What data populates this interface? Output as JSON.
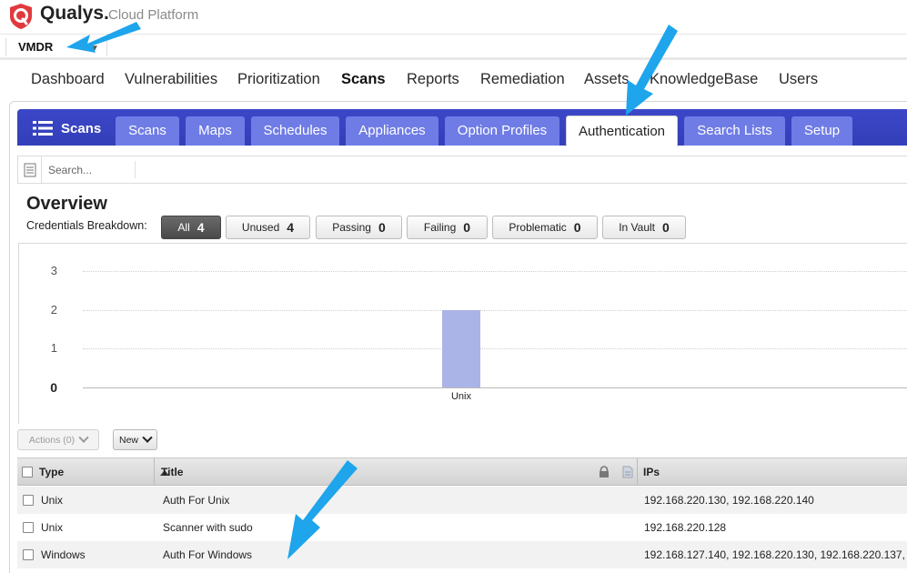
{
  "header": {
    "brand": "Qualys.",
    "platform": "Cloud Platform",
    "module": "VMDR"
  },
  "nav": [
    {
      "label": "Dashboard",
      "active": false
    },
    {
      "label": "Vulnerabilities",
      "active": false
    },
    {
      "label": "Prioritization",
      "active": false
    },
    {
      "label": "Scans",
      "active": true
    },
    {
      "label": "Reports",
      "active": false
    },
    {
      "label": "Remediation",
      "active": false
    },
    {
      "label": "Assets",
      "active": false
    },
    {
      "label": "KnowledgeBase",
      "active": false
    },
    {
      "label": "Users",
      "active": false
    }
  ],
  "panel": {
    "title": "Scans",
    "tabs": [
      {
        "label": "Scans",
        "active": false
      },
      {
        "label": "Maps",
        "active": false
      },
      {
        "label": "Schedules",
        "active": false
      },
      {
        "label": "Appliances",
        "active": false
      },
      {
        "label": "Option Profiles",
        "active": false
      },
      {
        "label": "Authentication",
        "active": true
      },
      {
        "label": "Search Lists",
        "active": false
      },
      {
        "label": "Setup",
        "active": false
      }
    ]
  },
  "search": {
    "placeholder": "Search..."
  },
  "overview": {
    "title": "Overview",
    "breakdown_label": "Credentials Breakdown:",
    "filters": [
      {
        "label": "All",
        "count": "4",
        "active": true
      },
      {
        "label": "Unused",
        "count": "4",
        "active": false
      },
      {
        "label": "Passing",
        "count": "0",
        "active": false
      },
      {
        "label": "Failing",
        "count": "0",
        "active": false
      },
      {
        "label": "Problematic",
        "count": "0",
        "active": false
      },
      {
        "label": "In Vault",
        "count": "0",
        "active": false
      }
    ]
  },
  "chart_data": {
    "type": "bar",
    "categories": [
      "Unix"
    ],
    "values": [
      2
    ],
    "ylim": [
      0,
      3
    ],
    "yticks": [
      "0",
      "1",
      "2",
      "3"
    ],
    "grid": true,
    "bar_color": "#aab4e6"
  },
  "actions": {
    "actions_label": "Actions (0)",
    "new_label": "New"
  },
  "table": {
    "columns": {
      "type": "Type",
      "title": "Title",
      "ips": "IPs"
    },
    "rows": [
      {
        "type": "Unix",
        "title": "Auth For Unix",
        "ips": "192.168.220.130, 192.168.220.140"
      },
      {
        "type": "Unix",
        "title": "Scanner with sudo",
        "ips": "192.168.220.128"
      },
      {
        "type": "Windows",
        "title": "Auth For Windows",
        "ips": "192.168.127.140, 192.168.220.130, 192.168.220.137,"
      }
    ]
  },
  "colors": {
    "accent": "#3a46c6",
    "tab": "#6f7ce6",
    "annotation_arrow": "#1ea5ec"
  }
}
